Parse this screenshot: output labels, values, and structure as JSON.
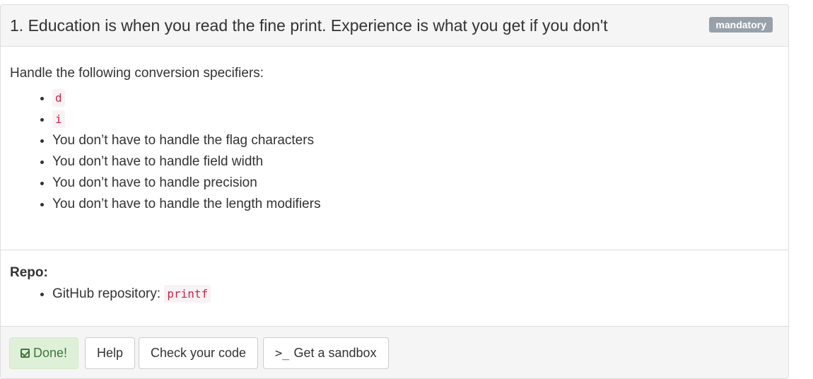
{
  "task": {
    "title": "1. Education is when you read the fine print. Experience is what you get if you don't",
    "badge": "mandatory"
  },
  "body": {
    "intro": "Handle the following conversion specifiers:",
    "specifiers": [
      "d",
      "i"
    ],
    "notes": [
      "You don’t have to handle the flag characters",
      "You don’t have to handle field width",
      "You don’t have to handle precision",
      "You don’t have to handle the length modifiers"
    ]
  },
  "repo": {
    "title": "Repo:",
    "item_label": "GitHub repository:",
    "item_value": "printf"
  },
  "footer": {
    "done_label": "Done!",
    "help_label": "Help",
    "check_label": "Check your code",
    "sandbox_icon": ">_",
    "sandbox_label": "Get a sandbox"
  },
  "colors": {
    "badge_bg": "#98a1a9",
    "code_text": "#c7254e",
    "code_bg": "#f9f2f4",
    "done_bg": "#dff0d8",
    "done_text": "#3c763d"
  }
}
